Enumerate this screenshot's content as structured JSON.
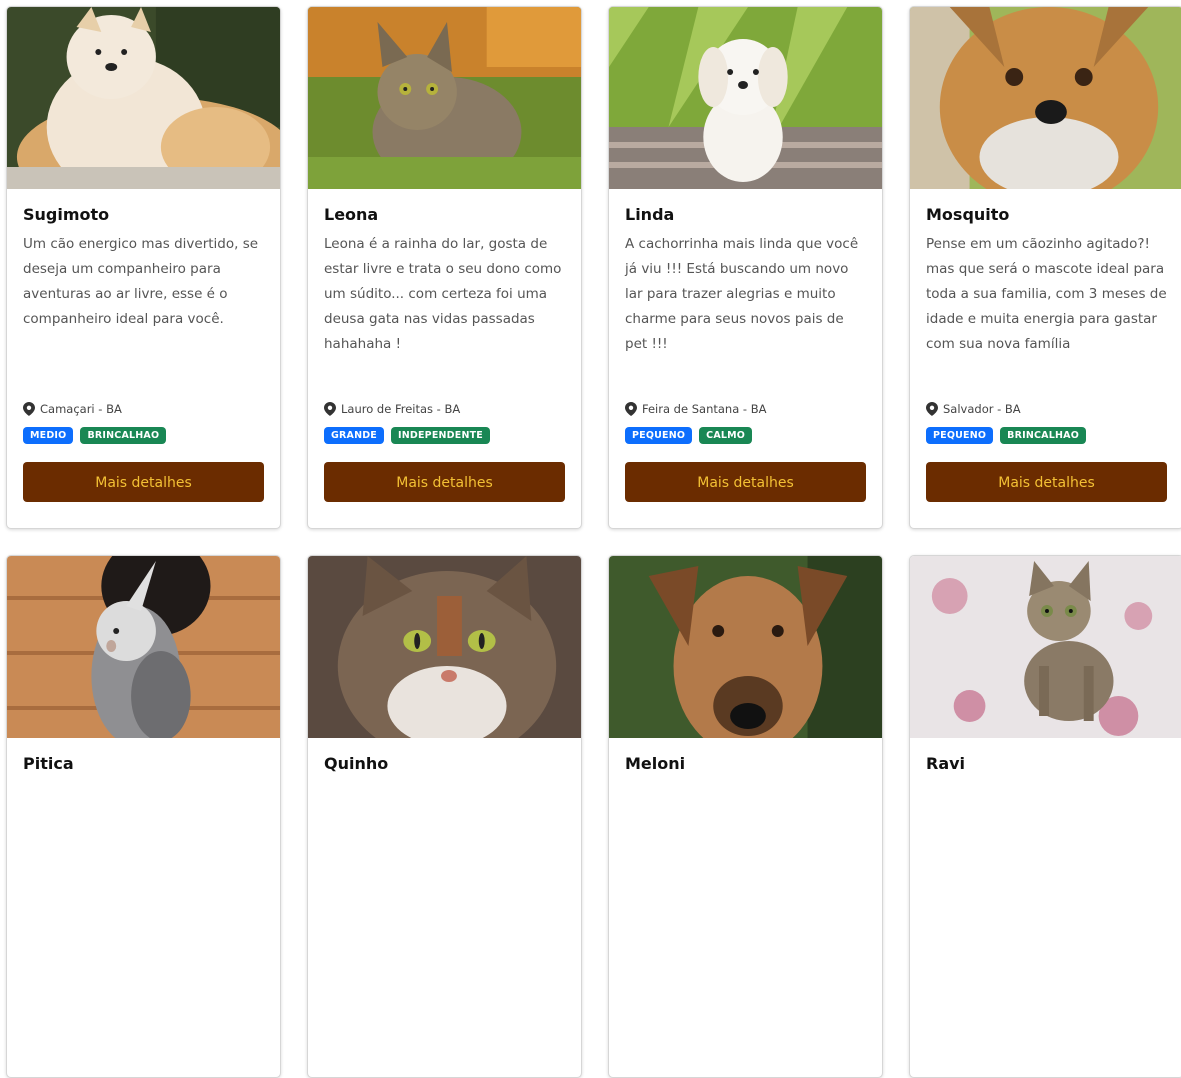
{
  "button_label": "Mais detalhes",
  "colors": {
    "button_bg": "#6b2c00",
    "button_text": "#f3c034",
    "tag_size": "#0d6efd",
    "tag_temper": "#198754"
  },
  "pets": [
    {
      "name": "Sugimoto",
      "description": "Um cão energico mas divertido, se deseja um companheiro para aventuras ao ar livre, esse é o companheiro ideal para você.",
      "location": "Camaçari - BA",
      "size": "MEDIO",
      "temperament": "BRINCALHAO",
      "photo": "akita-dog"
    },
    {
      "name": "Leona",
      "description": "Leona é a rainha do lar, gosta de estar livre e trata o seu dono como um súdito... com certeza foi uma deusa gata nas vidas passadas hahahaha !",
      "location": "Lauro de Freitas - BA",
      "size": "GRANDE",
      "temperament": "INDEPENDENTE",
      "photo": "tabby-cat-grass"
    },
    {
      "name": "Linda",
      "description": "A cachorrinha mais linda que você já viu !!! Está buscando um novo lar para trazer alegrias e muito charme para seus novos pais de pet !!!",
      "location": "Feira de Santana - BA",
      "size": "PEQUENO",
      "temperament": "CALMO",
      "photo": "maltese-dog"
    },
    {
      "name": "Mosquito",
      "description": "Pense em um cãozinho agitado?! mas que será o mascote ideal para toda a sua familia, com 3 meses de idade e muita energia para gastar com sua nova família",
      "location": "Salvador - BA",
      "size": "PEQUENO",
      "temperament": "BRINCALHAO",
      "photo": "yorkshire-dog"
    },
    {
      "name": "Pitica",
      "photo": "cockatiel-bird"
    },
    {
      "name": "Quinho",
      "photo": "cat-closeup"
    },
    {
      "name": "Meloni",
      "photo": "brown-dog"
    },
    {
      "name": "Ravi",
      "photo": "tabby-kitten"
    }
  ]
}
